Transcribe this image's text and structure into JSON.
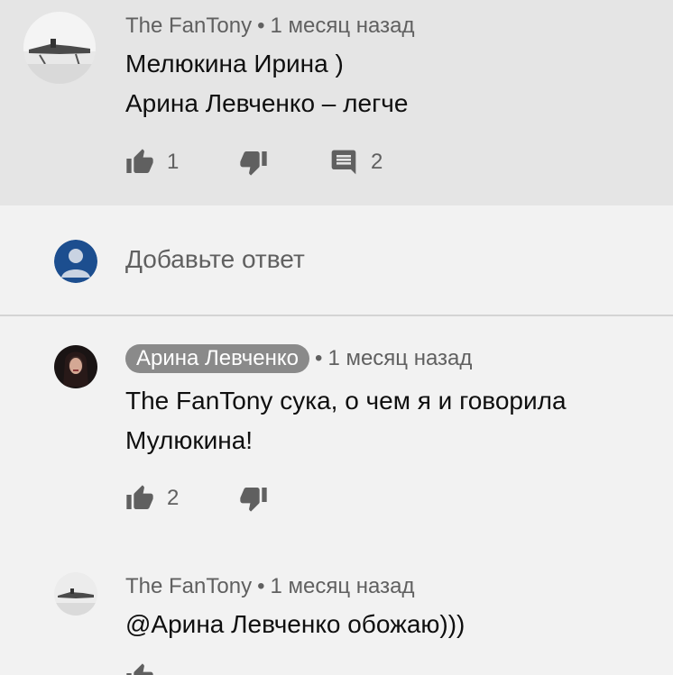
{
  "comments": [
    {
      "author": "The FanTony",
      "time": "1 месяц назад",
      "lines": [
        "Мелюкина Ирина )",
        "Арина Левченко – легче"
      ],
      "likes": "1",
      "replies": "2"
    },
    {
      "author": "Арина Левченко",
      "time": "1 месяц назад",
      "lines": [
        "The FanTony сука, о чем я и говорила",
        "Мулюкина!"
      ],
      "likes": "2"
    },
    {
      "author": "The FanTony",
      "time": "1 месяц назад",
      "lines": [
        "@Арина Левченко обожаю)))"
      ]
    }
  ],
  "reply_box": {
    "placeholder": "Добавьте ответ"
  },
  "separator": "•",
  "icons": {
    "like": "thumbs-up-icon",
    "dislike": "thumbs-down-icon",
    "reply": "comment-icon",
    "user": "user-avatar-icon"
  },
  "colors": {
    "highlight_bg": "#e5e5e5",
    "page_bg": "#f2f2f2",
    "secondary_text": "#606060",
    "avatar_blue": "#1c4e8f"
  }
}
